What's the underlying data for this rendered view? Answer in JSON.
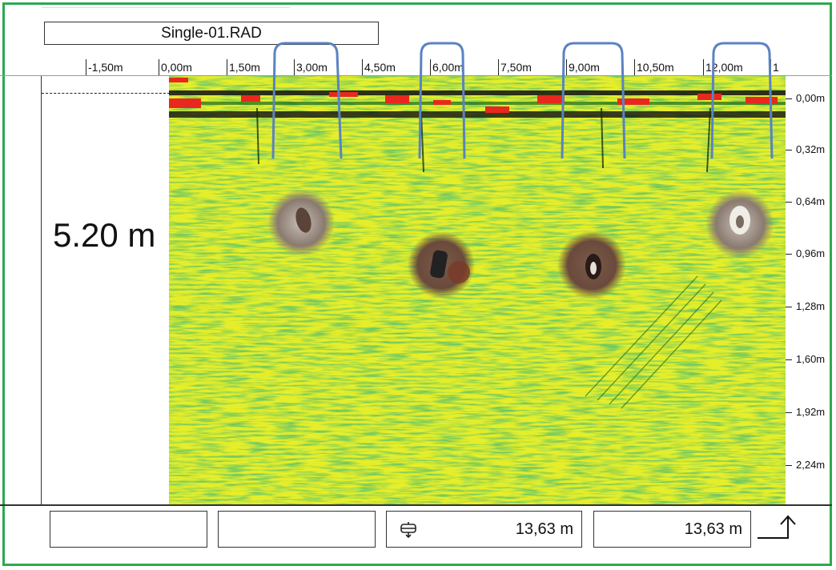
{
  "file": {
    "title": "Single-01.RAD"
  },
  "scan_label": "5.20 m",
  "horizontal_ruler": {
    "ticks": [
      "-1,50m",
      "0,00m",
      "1,50m",
      "3,00m",
      "4,50m",
      "6,00m",
      "7,50m",
      "9,00m",
      "10,50m",
      "12,00m",
      "1"
    ]
  },
  "depth_ruler": {
    "ticks": [
      "0,00m",
      "0,32m",
      "0,64m",
      "0,96m",
      "1,28m",
      "1,60m",
      "1,92m",
      "2,24m"
    ]
  },
  "status_bar": {
    "field1": "",
    "field2": "",
    "position_value": "13,63 m",
    "distance_value": "13,63 m",
    "position_icon": "measuring-wheel-icon",
    "export_icon": "export-arrow-icon"
  },
  "colors": {
    "frame": "#2fa84f",
    "radar_yellow": "#e6ee2a",
    "radar_green": "#5cb83a",
    "surface_red": "#e8281e",
    "marker_blue": "#5b82c2"
  }
}
